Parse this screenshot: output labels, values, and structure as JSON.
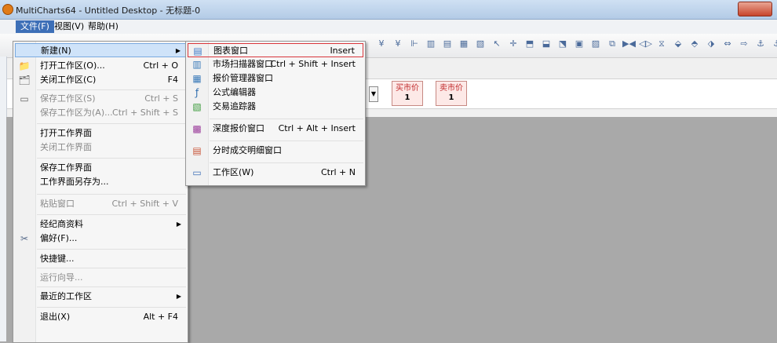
{
  "window": {
    "title": "MultiCharts64 - Untitled Desktop - 无标题-0"
  },
  "menubar": [
    "文件(F)",
    "视图(V)",
    "帮助(H)"
  ],
  "toolbar": {
    "buy_label": "买市价",
    "buy_qty": "1",
    "sell_label": "卖市价",
    "sell_qty": "1",
    "tool_icons": [
      "¥",
      "¥",
      "⊩",
      "▥",
      "▤",
      "▦",
      "▧",
      "↖",
      "✛",
      "⬒",
      "⬓",
      "⬔",
      "▣",
      "▨",
      "⧉",
      "▶◀",
      "◁▷",
      "⧖",
      "⬙",
      "⬘",
      "⬗",
      "⇔",
      "⇨",
      "⚓",
      "⚓",
      "🔍"
    ]
  },
  "file_menu": {
    "items": [
      {
        "label": "新建(N)",
        "shortcut": "",
        "submenu": true,
        "icon": ""
      },
      {
        "label": "打开工作区(O)...",
        "shortcut": "Ctrl + O",
        "icon": "folder-icon"
      },
      {
        "label": "关闭工作区(C)",
        "shortcut": "F4",
        "icon": "close-workspace-icon"
      },
      {
        "label": "保存工作区(S)",
        "shortcut": "Ctrl + S",
        "icon": "save-icon",
        "disabled": true
      },
      {
        "label": "保存工作区为(A)...",
        "shortcut": "Ctrl + Shift + S",
        "disabled": true
      },
      {
        "label": "打开工作界面",
        "shortcut": ""
      },
      {
        "label": "关闭工作界面",
        "shortcut": "",
        "disabled": true
      },
      {
        "label": "保存工作界面",
        "shortcut": ""
      },
      {
        "label": "工作界面另存为...",
        "shortcut": ""
      },
      {
        "label": "粘贴窗口",
        "shortcut": "Ctrl + Shift + V",
        "disabled": true
      },
      {
        "label": "经纪商资料",
        "shortcut": "",
        "submenu": true
      },
      {
        "label": "偏好(F)...",
        "shortcut": "",
        "icon": "tools-icon"
      },
      {
        "label": "快捷键...",
        "shortcut": ""
      },
      {
        "label": "运行向导...",
        "shortcut": "",
        "disabled": true
      },
      {
        "label": "最近的工作区",
        "shortcut": "",
        "submenu": true
      },
      {
        "label": "退出(X)",
        "shortcut": "Alt + F4"
      }
    ]
  },
  "new_submenu": {
    "items": [
      {
        "label": "图表窗口",
        "shortcut": "Insert",
        "icon": "chart-window-icon"
      },
      {
        "label": "市场扫描器窗口",
        "shortcut": "Ctrl + Shift + Insert",
        "icon": "scanner-icon"
      },
      {
        "label": "报价管理器窗口",
        "shortcut": "",
        "icon": "quote-manager-icon"
      },
      {
        "label": "公式编辑器",
        "shortcut": "",
        "icon": "formula-editor-icon"
      },
      {
        "label": "交易追踪器",
        "shortcut": "",
        "icon": "order-tracker-icon"
      },
      {
        "label": "深度报价窗口",
        "shortcut": "Ctrl + Alt + Insert",
        "icon": "dom-icon"
      },
      {
        "label": "分时成交明细窗口",
        "shortcut": "",
        "icon": "time-sales-icon"
      },
      {
        "label": "工作区(W)",
        "shortcut": "Ctrl + N",
        "icon": "workspace-icon"
      }
    ]
  },
  "colors": {
    "accent": "#3d6fb7",
    "highlight_border": "#d9353b",
    "workspace_bg": "#a9a9a9"
  }
}
